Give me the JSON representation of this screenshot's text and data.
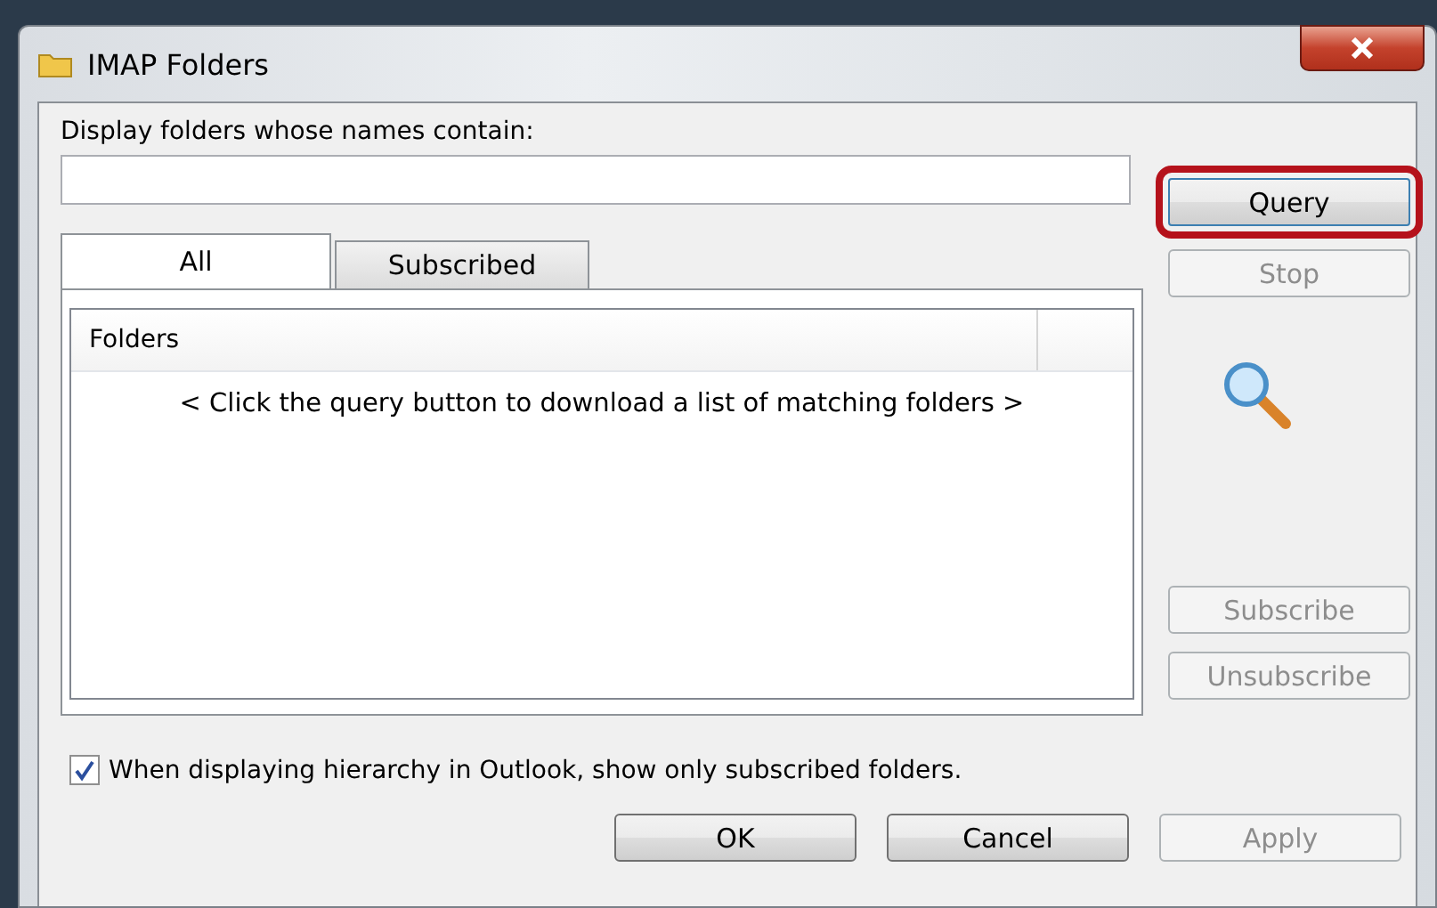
{
  "window": {
    "title": "IMAP Folders"
  },
  "filter": {
    "label": "Display folders whose names contain:"
  },
  "side_buttons": [
    {
      "label": "Query",
      "disabled": false,
      "highlighted": true
    },
    {
      "label": "Stop",
      "disabled": true,
      "highlighted": false
    },
    {
      "label": "Subscribe",
      "disabled": true,
      "highlighted": false
    },
    {
      "label": "Unsubscribe",
      "disabled": true,
      "highlighted": false
    }
  ],
  "tabs": [
    {
      "label": "All",
      "selected": true
    },
    {
      "label": "Subscribed",
      "selected": false
    }
  ],
  "list": {
    "columns": [
      "Folders"
    ],
    "message": "< Click the query button to download a list of matching folders >"
  },
  "option": {
    "label": "When displaying hierarchy in Outlook, show only subscribed folders.",
    "checked": true
  },
  "buttons": [
    {
      "label": "OK",
      "disabled": false
    },
    {
      "label": "Cancel",
      "disabled": false
    },
    {
      "label": "Apply",
      "disabled": true
    }
  ]
}
